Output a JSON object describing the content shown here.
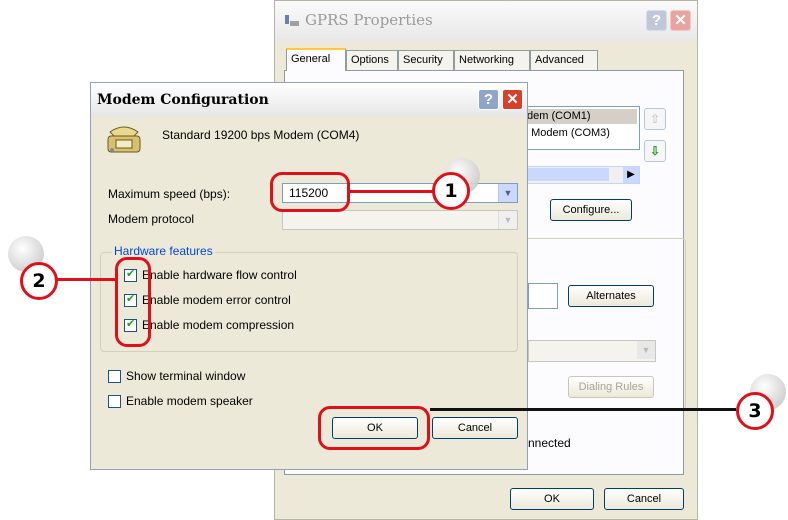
{
  "gprs_window": {
    "title": "GPRS Properties",
    "tabs": [
      "General",
      "Options",
      "Security",
      "Networking",
      "Advanced"
    ],
    "modem_list": [
      "dem (COM1)",
      ": Modem (COM3)"
    ],
    "configure_button": "Configure...",
    "alternates_button": "Alternates",
    "dialing_rules_button": "Dialing Rules",
    "connected_text": "nnected",
    "ok_button": "OK",
    "cancel_button": "Cancel"
  },
  "modem_window": {
    "title": "Modem Configuration",
    "modem_name": "Standard 19200 bps Modem (COM4)",
    "max_speed_label": "Maximum speed (bps):",
    "max_speed_value": "115200",
    "protocol_label": "Modem protocol",
    "hardware_group_label": "Hardware features",
    "hardware_features": [
      {
        "label": "Enable hardware flow control",
        "checked": true
      },
      {
        "label": "Enable modem error control",
        "checked": true
      },
      {
        "label": "Enable modem compression",
        "checked": true
      }
    ],
    "show_terminal_label": "Show terminal window",
    "show_terminal_checked": false,
    "speaker_label": "Enable modem speaker",
    "speaker_checked": false,
    "ok_button": "OK",
    "cancel_button": "Cancel"
  },
  "annotations": {
    "callout_1": "1",
    "callout_2": "2",
    "callout_3": "3",
    "color": "#e0101a"
  }
}
